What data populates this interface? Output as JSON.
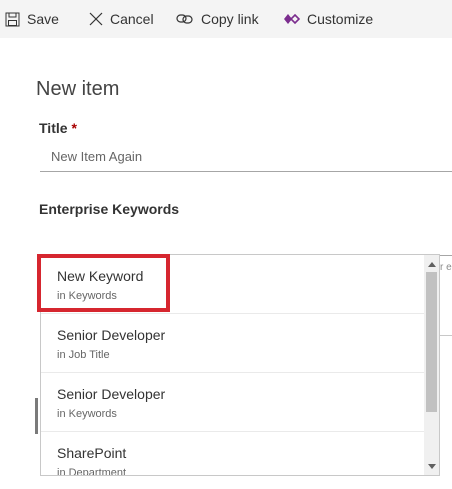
{
  "toolbar": {
    "save_label": "Save",
    "cancel_label": "Cancel",
    "copy_link_label": "Copy link",
    "customize_label": "Customize"
  },
  "form": {
    "heading": "New item",
    "title_label": "Title",
    "required_marker": "*",
    "title_value": "New Item Again",
    "keywords_label": "Enterprise Keywords",
    "keywords_value": ""
  },
  "background": {
    "clipped_text": "r e"
  },
  "suggestions": [
    {
      "name": "New Keyword",
      "source": "in Keywords"
    },
    {
      "name": "Senior Developer",
      "source": "in Job Title"
    },
    {
      "name": "Senior Developer",
      "source": "in Keywords"
    },
    {
      "name": "SharePoint",
      "source": "in Department"
    }
  ],
  "colors": {
    "highlight": "#d6262f",
    "customize_icon": "#7b2d8e"
  }
}
